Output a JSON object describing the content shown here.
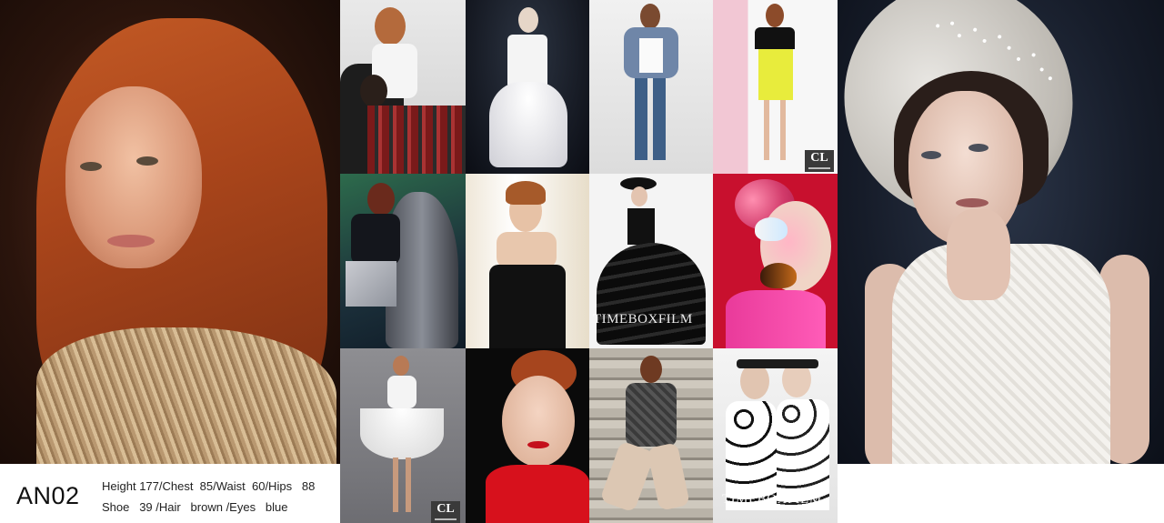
{
  "model": {
    "code": "AN02",
    "stats_line_1": "Height 177/Chest  85/Waist  60/Hips   88",
    "stats_line_2": "Shoe   39 /Hair   brown /Eyes   blue"
  },
  "watermarks": {
    "timebox_1": "TIMEBOXFILM",
    "timebox_2": "TIMEBOXFILM",
    "cl_1": "CL",
    "cl_2": "CL"
  },
  "colors": {
    "background": "#ffffff",
    "text": "#222222",
    "accent_red": "#c8102e"
  }
}
